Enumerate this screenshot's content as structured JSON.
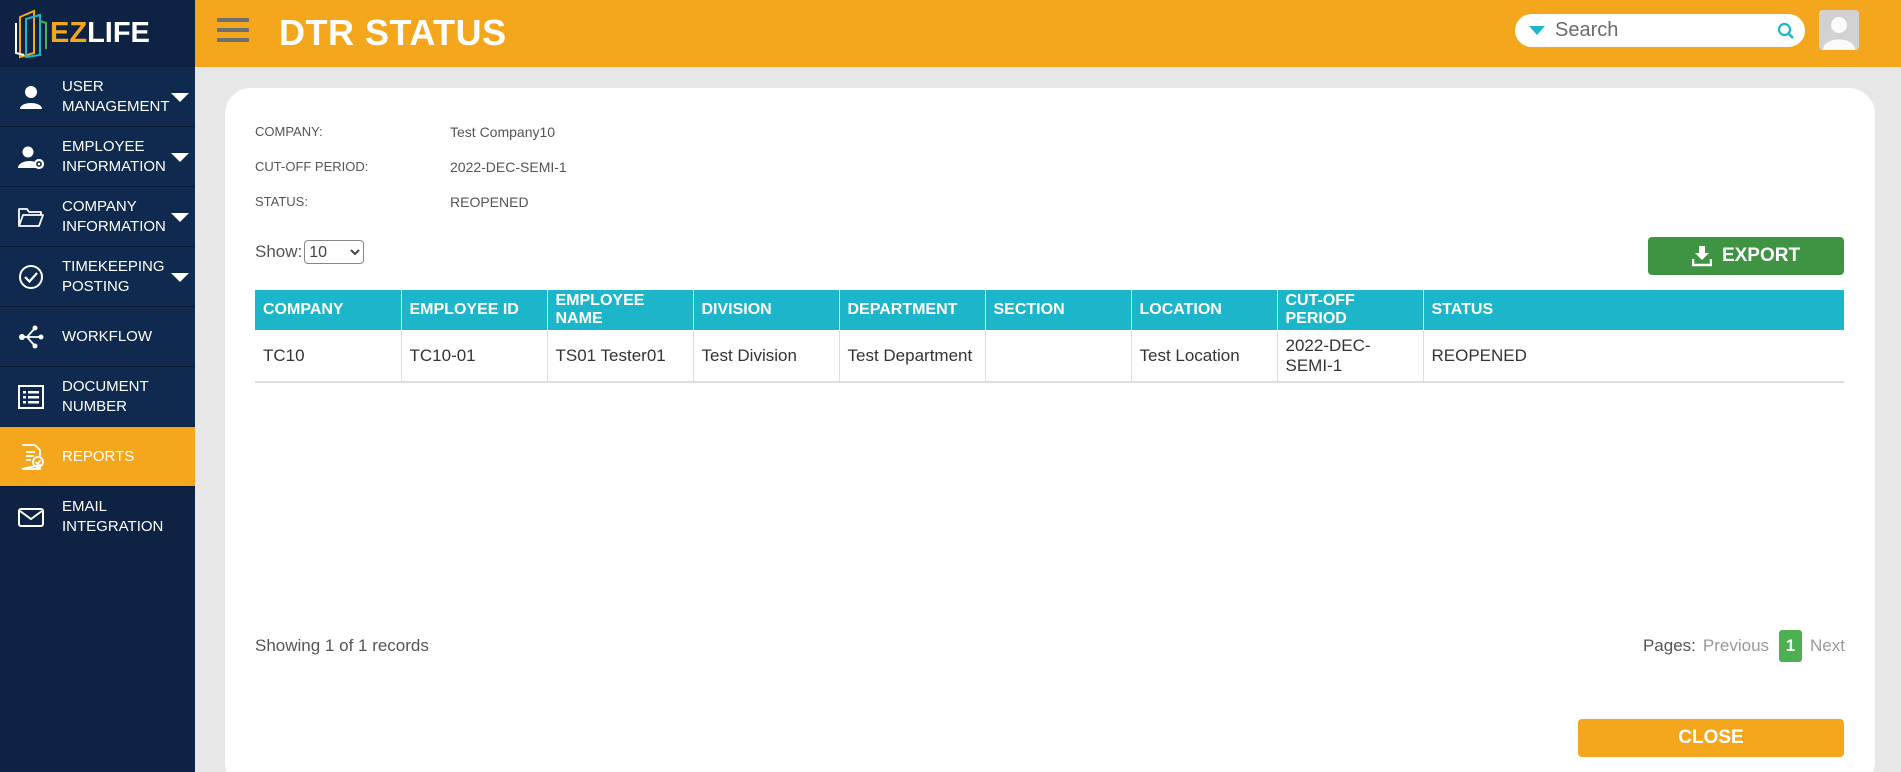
{
  "app": {
    "logo_ez": "EZ",
    "logo_life": "LIFE"
  },
  "header": {
    "title": "DTR STATUS",
    "search_placeholder": "Search"
  },
  "sidebar": {
    "items": [
      {
        "label": "USER MANAGEMENT",
        "icon": "user-icon",
        "expandable": true
      },
      {
        "label": "EMPLOYEE INFORMATION",
        "icon": "user-gear-icon",
        "expandable": true
      },
      {
        "label": "COMPANY INFORMATION",
        "icon": "folder-icon",
        "expandable": true
      },
      {
        "label": "TIMEKEEPING POSTING",
        "icon": "check-circle-icon",
        "expandable": true
      },
      {
        "label": "WORKFLOW",
        "icon": "workflow-icon",
        "expandable": false
      },
      {
        "label": "DOCUMENT NUMBER",
        "icon": "list-icon",
        "expandable": false
      },
      {
        "label": "REPORTS",
        "icon": "report-icon",
        "expandable": false,
        "active": true
      },
      {
        "label": "EMAIL INTEGRATION",
        "icon": "mail-icon",
        "expandable": false
      }
    ]
  },
  "info": {
    "company_label": "COMPANY:",
    "company_value": "Test Company10",
    "cutoff_label": "CUT-OFF PERIOD:",
    "cutoff_value": "2022-DEC-SEMI-1",
    "status_label": "STATUS:",
    "status_value": "REOPENED"
  },
  "controls": {
    "show_label": "Show:",
    "show_value": "10",
    "export_label": "EXPORT"
  },
  "table": {
    "headers": [
      "COMPANY",
      "EMPLOYEE ID",
      "EMPLOYEE NAME",
      "DIVISION",
      "DEPARTMENT",
      "SECTION",
      "LOCATION",
      "CUT-OFF PERIOD",
      "STATUS"
    ],
    "rows": [
      [
        "TC10",
        "TC10-01",
        "TS01 Tester01",
        "Test Division",
        "Test Department",
        "",
        "Test Location",
        "2022-DEC-SEMI-1",
        "REOPENED"
      ]
    ]
  },
  "footer": {
    "records_text": "Showing 1 of 1 records",
    "pages_label": "Pages:",
    "previous_label": "Previous",
    "current_page": "1",
    "next_label": "Next",
    "close_label": "CLOSE"
  },
  "colors": {
    "accent": "#f4a71d",
    "sidebar": "#0e2244",
    "table_header": "#1cb5c9",
    "export": "#3e9443",
    "page_active": "#4caf50"
  }
}
